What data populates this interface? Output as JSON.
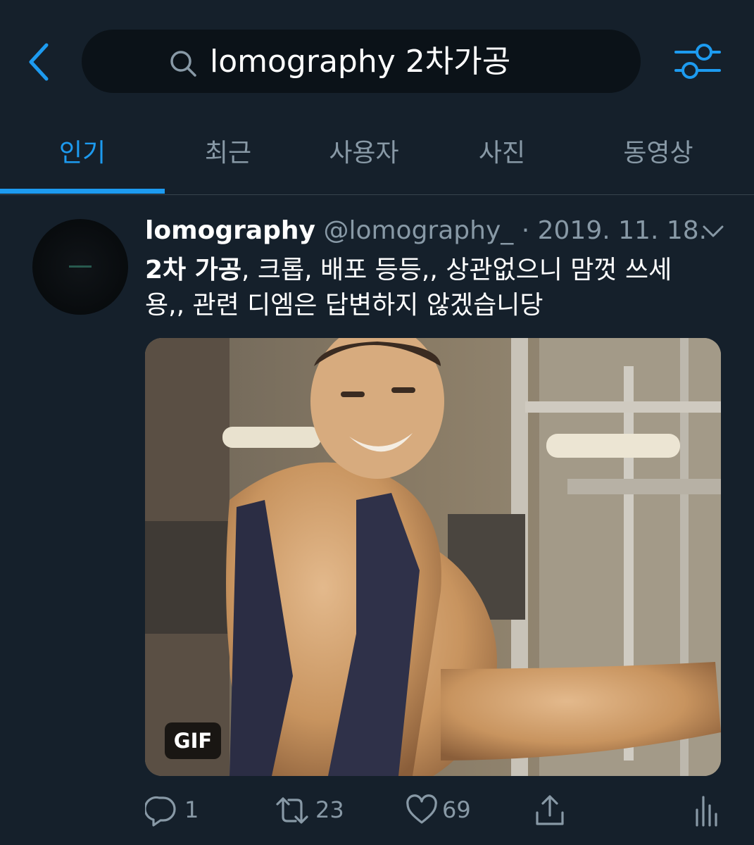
{
  "search": {
    "query": "lomography 2차가공"
  },
  "tabs": [
    {
      "label": "인기",
      "active": true
    },
    {
      "label": "최근",
      "active": false
    },
    {
      "label": "사용자",
      "active": false
    },
    {
      "label": "사진",
      "active": false
    },
    {
      "label": "동영상",
      "active": false
    }
  ],
  "icons": {
    "back": "chevron-left-icon",
    "search": "search-icon",
    "filter": "sliders-icon",
    "more": "chevron-down-icon",
    "reply": "reply-icon",
    "retweet": "retweet-icon",
    "like": "heart-icon",
    "share": "share-icon",
    "analytics": "analytics-icon"
  },
  "colors": {
    "background": "#15202b",
    "accent": "#1d9bf0",
    "secondary_text": "#8899a6",
    "divider": "#38444d"
  },
  "tweet": {
    "name": "lomography",
    "handle": "@lomography_",
    "separator": "·",
    "date": "2019. 11. 18.",
    "text_bold": "2차 가공",
    "text_rest": ", 크롭, 배포 등등,, 상관없으니 맘껏 쓰세용,, 관련 디엠은 답변하지 않겠습니당",
    "media_badge": "GIF",
    "reply_count": "1",
    "retweet_count": "23",
    "like_count": "69"
  }
}
